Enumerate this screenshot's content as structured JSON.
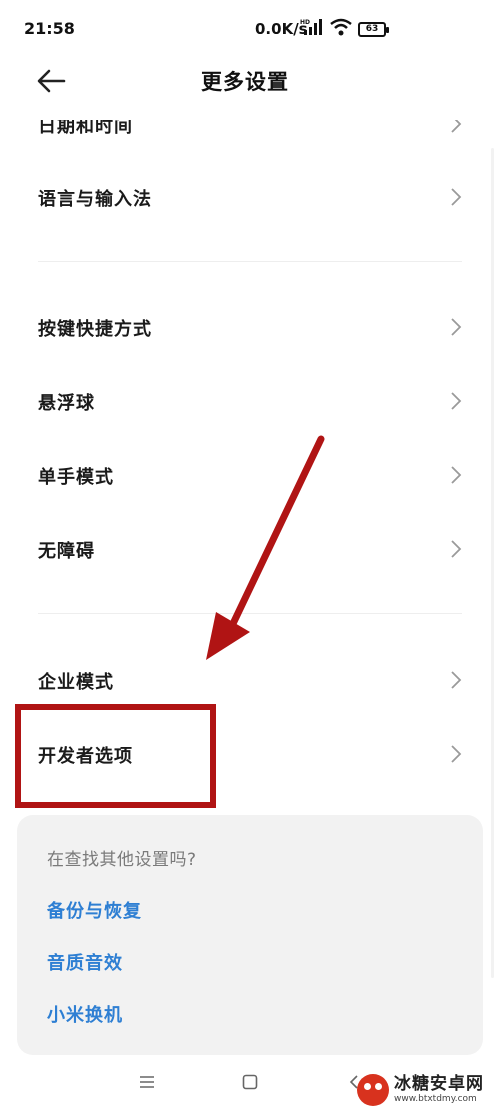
{
  "status_bar": {
    "time": "21:58",
    "network_speed": "0.0K/s",
    "battery_level": "63",
    "icons": [
      "hd-signal-icon",
      "wifi-icon",
      "battery-icon"
    ]
  },
  "header": {
    "title": "更多设置",
    "back_icon": "arrow-left-icon"
  },
  "menu": {
    "groups": [
      {
        "items": [
          {
            "label": "日期和时间"
          },
          {
            "label": "语言与输入法"
          }
        ]
      },
      {
        "items": [
          {
            "label": "按键快捷方式"
          },
          {
            "label": "悬浮球"
          },
          {
            "label": "单手模式"
          },
          {
            "label": "无障碍"
          }
        ]
      },
      {
        "items": [
          {
            "label": "企业模式"
          },
          {
            "label": "开发者选项"
          }
        ]
      }
    ],
    "chevron_icon": "chevron-right-icon"
  },
  "search_card": {
    "title": "在查找其他设置吗?",
    "links": [
      "备份与恢复",
      "音质音效",
      "小米换机"
    ]
  },
  "nav_bar": {
    "buttons": [
      "menu-icon",
      "home-icon",
      "back-icon"
    ]
  },
  "annotation": {
    "color": "#b01414",
    "target": "开发者选项"
  },
  "watermark": {
    "name": "冰糖安卓网",
    "url": "www.btxtdmy.com"
  },
  "colors": {
    "link": "#2e7fd3",
    "card_bg": "#f2f2f2",
    "text": "#1a1a1a"
  }
}
